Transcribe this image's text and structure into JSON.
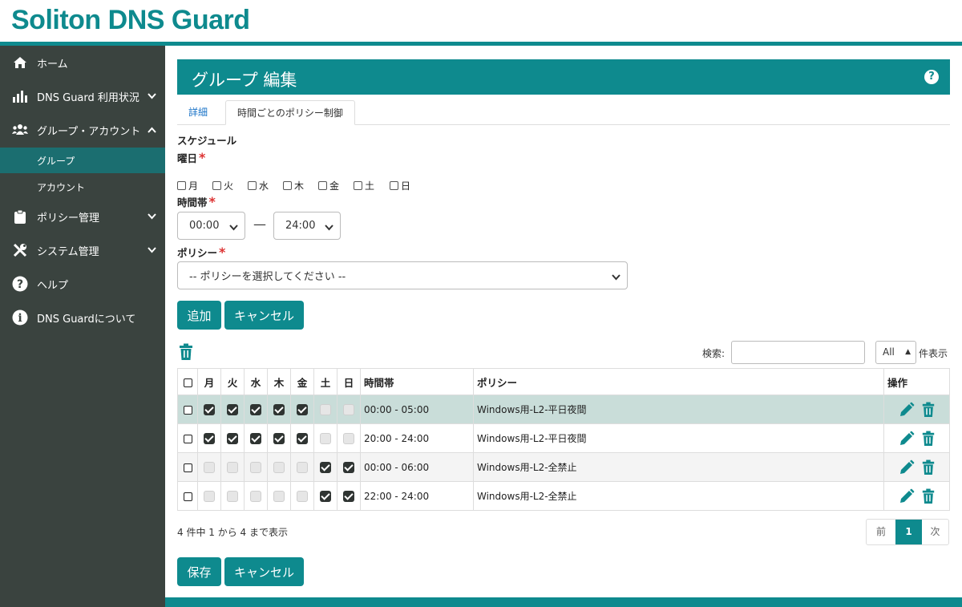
{
  "app": {
    "title": "Soliton DNS Guard",
    "brand_color": "#0e8a8e",
    "sidebar_color": "#3a433f"
  },
  "sidebar": {
    "items": [
      {
        "label": "ホーム",
        "icon": "home-icon"
      },
      {
        "label": "DNS Guard 利用状況",
        "icon": "chart-icon"
      },
      {
        "label": "グループ・アカウント",
        "icon": "users-icon"
      },
      {
        "label": "グループ",
        "active": true
      },
      {
        "label": "アカウント"
      },
      {
        "label": "ポリシー管理",
        "icon": "clipboard-icon"
      },
      {
        "label": "システム管理",
        "icon": "tools-icon"
      },
      {
        "label": "ヘルプ",
        "icon": "question-icon"
      },
      {
        "label": "DNS Guardについて",
        "icon": "info-icon"
      }
    ]
  },
  "page": {
    "title": "グループ 編集",
    "help": "?",
    "tabs": [
      {
        "label": "詳細"
      },
      {
        "label": "時間ごとのポリシー制御",
        "active": true
      }
    ]
  },
  "form": {
    "schedule_label": "スケジュール",
    "days_label": "曜日",
    "days": [
      "月",
      "火",
      "水",
      "木",
      "金",
      "土",
      "日"
    ],
    "time_label": "時間帯",
    "time_start": "00:00",
    "time_dash": "—",
    "time_end": "24:00",
    "policy_label": "ポリシー",
    "policy_placeholder": "-- ポリシーを選択してください --",
    "required_mark": "*",
    "add_button": "追加",
    "cancel_button": "キャンセル"
  },
  "table_controls": {
    "search_label": "検索:",
    "search_value": "",
    "length_value": "All",
    "length_suffix": "件表示"
  },
  "table": {
    "headers": [
      "月",
      "火",
      "水",
      "木",
      "金",
      "土",
      "日",
      "時間帯",
      "ポリシー",
      "操作"
    ],
    "rows": [
      {
        "days": [
          true,
          true,
          true,
          true,
          true,
          false,
          false
        ],
        "time": "00:00 - 05:00",
        "policy": "Windows用-L2-平日夜間"
      },
      {
        "days": [
          true,
          true,
          true,
          true,
          true,
          false,
          false
        ],
        "time": "20:00 - 24:00",
        "policy": "Windows用-L2-平日夜間"
      },
      {
        "days": [
          false,
          false,
          false,
          false,
          false,
          true,
          true
        ],
        "time": "00:00 - 06:00",
        "policy": "Windows用-L2-全禁止"
      },
      {
        "days": [
          false,
          false,
          false,
          false,
          false,
          true,
          true
        ],
        "time": "22:00 - 24:00",
        "policy": "Windows用-L2-全禁止"
      }
    ]
  },
  "pagination": {
    "info": "4 件中 1 から 4 まで表示",
    "prev": "前",
    "current": "1",
    "next": "次"
  },
  "footer_buttons": {
    "save": "保存",
    "cancel": "キャンセル"
  }
}
